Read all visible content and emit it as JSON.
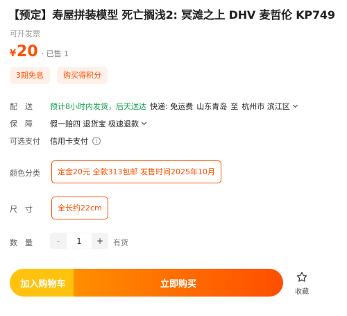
{
  "product": {
    "title": "【预定】寿屋拼装模型 死亡搁浅2: 冥滩之上 DHV 麦哲伦 KP749",
    "invoice_note": "可开发票"
  },
  "price": {
    "symbol": "¥",
    "value": "20",
    "sold": "· 已售 1"
  },
  "promo_tags": [
    "3期免息",
    "购买得积分"
  ],
  "delivery": {
    "label": "配　送",
    "shipping_time": "预计8小时内发货，后天送达",
    "courier": "快递: 免运费",
    "origin": "山东青岛",
    "to": "至",
    "destination": "杭州市 滨江区"
  },
  "guarantee": {
    "label": "保　障",
    "text": "假一赔四 退货宝 极速退款"
  },
  "payment": {
    "label": "可选支付",
    "text": "信用卡支付",
    "info_icon": "info-icon"
  },
  "color_option": {
    "label": "颜色分类",
    "selected": "定金20元 全款313包邮 发售时间2025年10月"
  },
  "size_option": {
    "label": "尺　寸",
    "selected": "全长约22cm"
  },
  "quantity": {
    "label": "数　量",
    "minus": "-",
    "value": "1",
    "plus": "+",
    "stock": "有货"
  },
  "actions": {
    "add_to_cart": "加入购物车",
    "buy_now": "立即购买",
    "favorite": "收藏",
    "favorite_icon": "star-outline-icon"
  },
  "colors": {
    "accent": "#ff5000",
    "green": "#11a04b",
    "cart_yellow": "#ffc30f"
  }
}
